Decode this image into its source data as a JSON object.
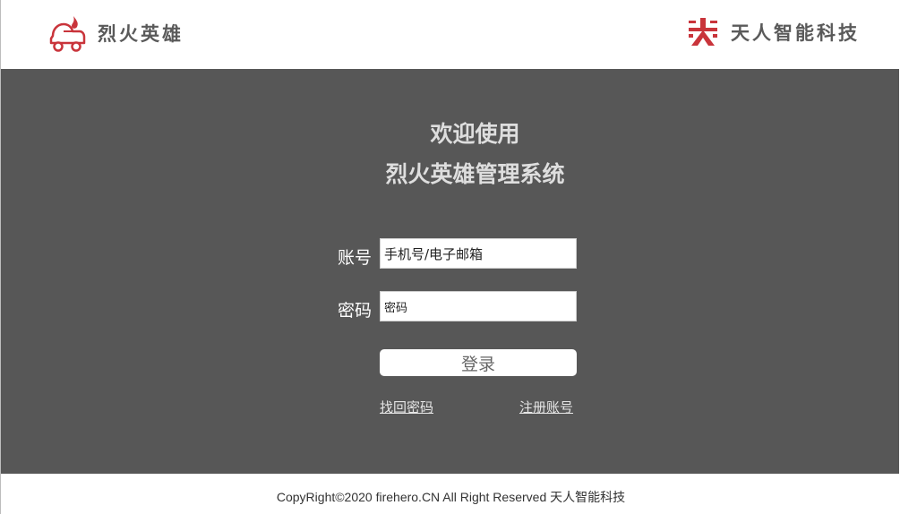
{
  "header": {
    "brand_name": "烈火英雄",
    "company_name": "天人智能科技"
  },
  "colors": {
    "brand_red": "#c9343b",
    "main_bg": "#575757",
    "header_text": "#5a5a5a"
  },
  "icons": {
    "brand_logo": "fire-car-logo-icon",
    "company_logo": "tianren-logo-icon"
  },
  "welcome": {
    "line1": "欢迎使用",
    "line2": "烈火英雄管理系统"
  },
  "form": {
    "account_label": "账号",
    "account_value": "手机号/电子邮箱",
    "password_label": "密码",
    "password_value": "密码",
    "login_label": "登录",
    "forgot_label": "找回密码",
    "register_label": "注册账号"
  },
  "footer": {
    "copyright": "CopyRight©2020 firehero.CN All Right Reserved 天人智能科技"
  }
}
